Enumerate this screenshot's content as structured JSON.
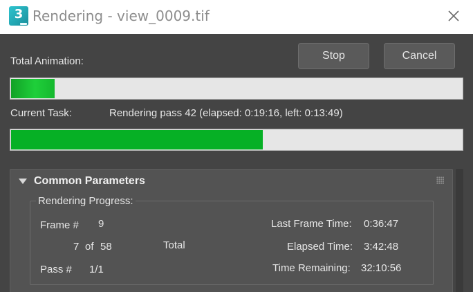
{
  "window": {
    "app_icon_glyph": "3",
    "app_icon": "3ds-max-icon",
    "title": "Rendering - view_0009.tif",
    "close_icon": "close-icon"
  },
  "buttons": {
    "stop": "Stop",
    "cancel": "Cancel"
  },
  "total_animation": {
    "label": "Total Animation:",
    "progress": 0.1
  },
  "current_task": {
    "label": "Current Task:",
    "status": "Rendering pass 42 (elapsed: 0:19:16, left: 0:13:49)",
    "progress": 0.56
  },
  "colors": {
    "progress_green": "#06b025",
    "dialog_bg": "#444444"
  },
  "common_parameters": {
    "title": "Common Parameters",
    "rendering_progress": {
      "label": "Rendering Progress:",
      "frame_label": "Frame #",
      "frame_value": "9",
      "frames_done": "7",
      "of_label": "of",
      "frames_total": "58",
      "total_label": "Total",
      "pass_label": "Pass #",
      "pass_value": "1/1",
      "last_frame_time_label": "Last Frame Time:",
      "last_frame_time_value": "0:36:47",
      "elapsed_time_label": "Elapsed Time:",
      "elapsed_time_value": "3:42:48",
      "time_remaining_label": "Time Remaining:",
      "time_remaining_value": "32:10:56"
    }
  }
}
